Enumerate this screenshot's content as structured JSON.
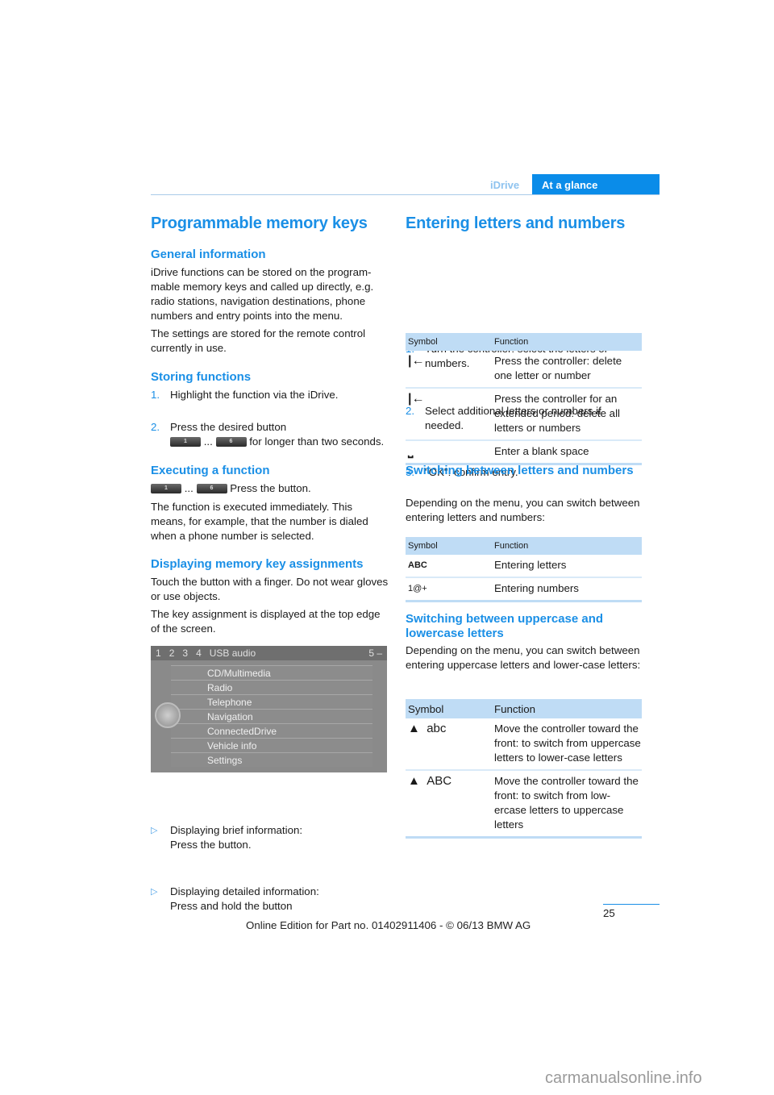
{
  "header": {
    "section": "iDrive",
    "chapter": "At a glance"
  },
  "left": {
    "title": "Programmable memory keys",
    "general": {
      "heading": "General information",
      "p1": "iDrive functions can be stored on the program-mable memory keys and called up directly, e.g. radio stations, navigation destinations, phone numbers and entry points into the menu.",
      "p2": "The settings are stored for the remote control currently in use."
    },
    "storing": {
      "heading": "Storing functions",
      "steps": [
        {
          "num": "1.",
          "text": "Highlight the function via the iDrive."
        },
        {
          "num": "2.",
          "text_a": "Press the desired button",
          "dots": "...",
          "text_b": "for longer than two seconds."
        }
      ]
    },
    "executing": {
      "heading": "Executing a function",
      "dots": "...",
      "line": "Press the button.",
      "p": "The function is executed immediately. This means, for example, that the number is dialed when a phone number is selected."
    },
    "keys": {
      "first": "1",
      "last": "6"
    },
    "displaying": {
      "heading": "Displaying memory key assignments",
      "p1": "Touch the button with a finger. Do not wear gloves or use objects.",
      "p2": "The key assignment is displayed at the top edge of the screen.",
      "bullets": [
        {
          "marker": "▷",
          "line1": "Displaying brief information:",
          "line2": "Press the button."
        },
        {
          "marker": "▷",
          "line1": "Displaying detailed information:",
          "line2": "Press and hold the button"
        }
      ]
    },
    "screen": {
      "top_keys": [
        "1",
        "2",
        "3",
        "4",
        "USB audio",
        "5 –"
      ],
      "menu": [
        "CD/Multimedia",
        "Radio",
        "Telephone",
        "Navigation",
        "ConnectedDrive",
        "Vehicle info",
        "Settings"
      ]
    }
  },
  "right": {
    "title": "Entering letters and numbers",
    "steps": [
      {
        "num": "1.",
        "text": "Turn the controller: select the letters or numbers."
      },
      {
        "num": "2.",
        "text": "Select additional letters or numbers if needed."
      },
      {
        "num": "3.",
        "text": "\"OK\": confirm entry."
      }
    ],
    "table1": {
      "headers": [
        "Symbol",
        "Function"
      ],
      "rows": [
        {
          "symbol": "|←",
          "function": "Press the controller: delete one letter or number"
        },
        {
          "symbol": "|←",
          "function": "Press the controller for an extended period: delete all letters or numbers"
        },
        {
          "symbol": "⎵",
          "function": "Enter a blank space"
        }
      ]
    },
    "switch_ln": {
      "heading": "Switching between letters and numbers",
      "p": "Depending on the menu, you can switch between entering letters and numbers:",
      "headers": [
        "Symbol",
        "Function"
      ],
      "rows": [
        {
          "symbol": "ABC",
          "function": "Entering letters"
        },
        {
          "symbol": "1@+",
          "function": "Entering numbers"
        }
      ]
    },
    "switch_case": {
      "heading": "Switching between uppercase and lowercase letters",
      "p": "Depending on the menu, you can switch between entering uppercase letters and lower-case letters:",
      "headers": [
        "Symbol",
        "Function"
      ],
      "rows": [
        {
          "arrow": "▲",
          "symbol": "abc",
          "function": "Move the controller toward the front: to switch from uppercase letters to lower-case letters"
        },
        {
          "arrow": "▲",
          "symbol": "ABC",
          "function": "Move the controller toward the front: to switch from low-ercase letters to uppercase letters"
        }
      ]
    }
  },
  "footer": {
    "page": "25",
    "edition": "Online Edition for Part no. 01402911406 - © 06/13 BMW AG"
  },
  "watermark": "carmanualsonline.info"
}
